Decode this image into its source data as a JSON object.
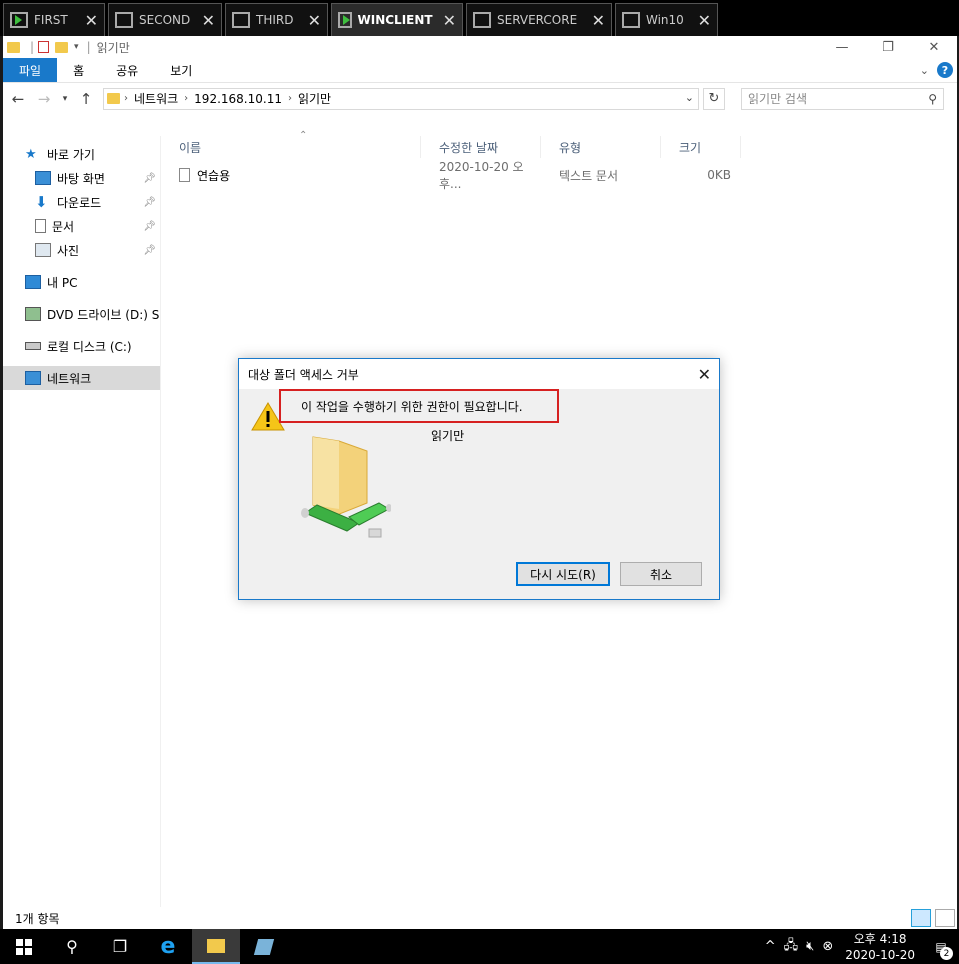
{
  "vm_tabs": [
    {
      "label": "FIRST",
      "icon": "vm-window-icon"
    },
    {
      "label": "SECOND",
      "icon": "vm-window-icon"
    },
    {
      "label": "THIRD",
      "icon": "vm-window-icon"
    },
    {
      "label": "WINCLIENT",
      "icon": "vm-running-icon",
      "active": true
    },
    {
      "label": "SERVERCORE",
      "icon": "vm-window-icon"
    },
    {
      "label": "Win10",
      "icon": "vm-window-icon"
    }
  ],
  "window": {
    "title": "읽기만",
    "qa_sep": "|"
  },
  "ribbon": {
    "tabs": [
      "파일",
      "홈",
      "공유",
      "보기"
    ]
  },
  "address": {
    "segments": [
      "네트워크",
      "192.168.10.11",
      "읽기만"
    ],
    "search_placeholder": "읽기만 검색"
  },
  "nav": {
    "quick_access": "바로 가기",
    "items": [
      {
        "label": "바탕 화면",
        "icon": "desktop-icon",
        "pinned": true
      },
      {
        "label": "다운로드",
        "icon": "download-icon",
        "pinned": true
      },
      {
        "label": "문서",
        "icon": "document-icon",
        "pinned": true
      },
      {
        "label": "사진",
        "icon": "picture-icon",
        "pinned": true
      }
    ],
    "this_pc": "내 PC",
    "dvd": "DVD 드라이브 (D:) S",
    "local_disk": "로컬 디스크 (C:)",
    "network": "네트워크"
  },
  "columns": {
    "name": "이름",
    "modified": "수정한 날짜",
    "type": "유형",
    "size": "크기"
  },
  "files": [
    {
      "name": "연습용",
      "modified": "2020-10-20 오후...",
      "type": "텍스트 문서",
      "size": "0KB"
    }
  ],
  "status": {
    "count": "1개 항목"
  },
  "dialog": {
    "title": "대상 폴더 액세스 거부",
    "message": "이 작업을 수행하기 위한 권한이 필요합니다.",
    "folder_name": "읽기만",
    "retry_label": "다시 시도(R)",
    "cancel_label": "취소"
  },
  "taskbar": {
    "time": "오후 4:18",
    "date": "2020-10-20",
    "notification_count": "2"
  },
  "colors": {
    "accent": "#1979ca",
    "highlight_border": "#d62020"
  }
}
